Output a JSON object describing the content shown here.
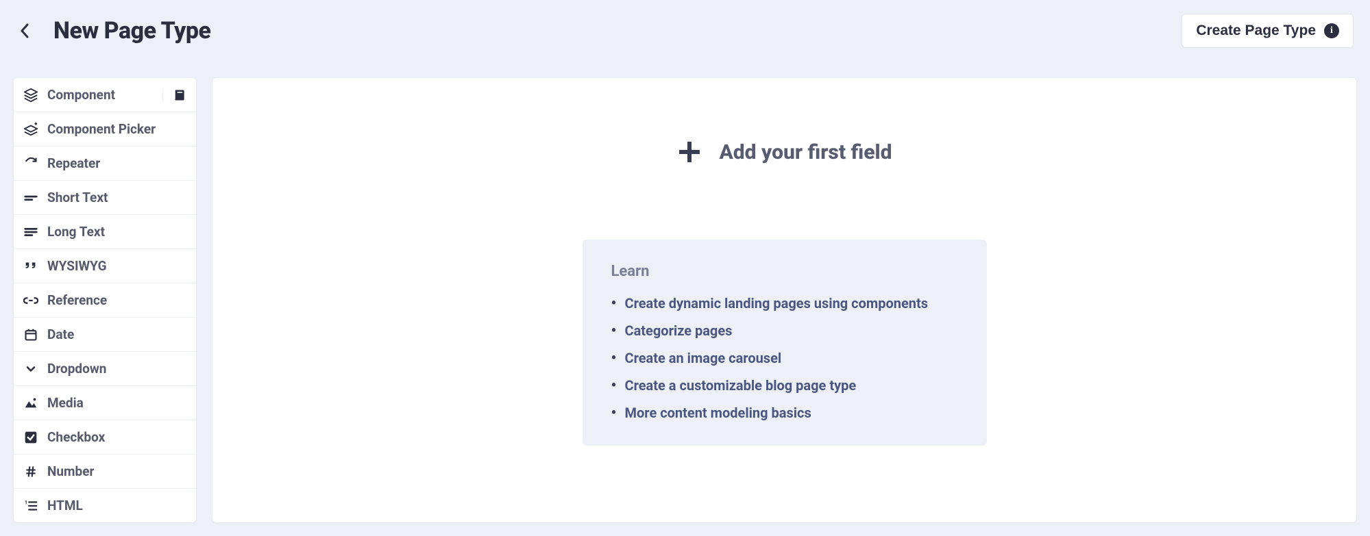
{
  "header": {
    "title": "New Page Type",
    "create_label": "Create Page Type"
  },
  "sidebar": {
    "items": [
      {
        "label": "Component",
        "icon": "layers"
      },
      {
        "label": "Component Picker",
        "icon": "layers-plus"
      },
      {
        "label": "Repeater",
        "icon": "repeat"
      },
      {
        "label": "Short Text",
        "icon": "short-text"
      },
      {
        "label": "Long Text",
        "icon": "long-text"
      },
      {
        "label": "WYSIWYG",
        "icon": "quotes"
      },
      {
        "label": "Reference",
        "icon": "link"
      },
      {
        "label": "Date",
        "icon": "calendar"
      },
      {
        "label": "Dropdown",
        "icon": "chevron-down"
      },
      {
        "label": "Media",
        "icon": "media"
      },
      {
        "label": "Checkbox",
        "icon": "checkbox"
      },
      {
        "label": "Number",
        "icon": "hash"
      },
      {
        "label": "HTML",
        "icon": "list-num"
      }
    ]
  },
  "main": {
    "add_label": "Add your first field",
    "learn": {
      "title": "Learn",
      "items": [
        "Create dynamic landing pages using components",
        "Categorize pages",
        "Create an image carousel",
        "Create a customizable blog page type",
        "More content modeling basics"
      ]
    }
  }
}
